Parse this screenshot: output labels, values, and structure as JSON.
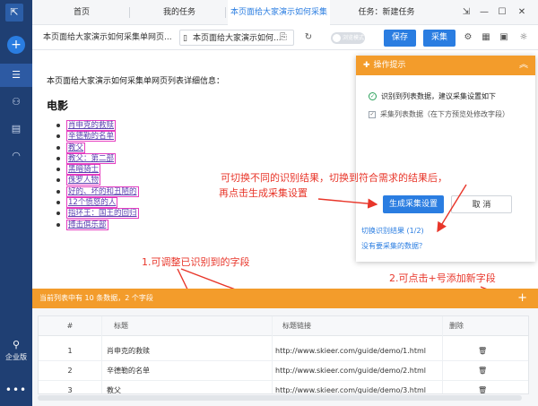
{
  "sidebar": {
    "logo": "⇱",
    "add_label": "+",
    "user_label": "企业版",
    "more_label": "•••"
  },
  "tabs": [
    {
      "label": "首页"
    },
    {
      "label": "我的任务"
    },
    {
      "label": "本页面给大家演示如何采集"
    },
    {
      "label": "任务：新建任务"
    }
  ],
  "toolbar": {
    "breadcrumb": "本页面给大家演示如何采集单网页...",
    "url": "本页面给大家演示如何...",
    "toggle_label": "浏览模式",
    "save_label": "保存",
    "collect_label": "采集"
  },
  "page": {
    "intro": "本页面给大家演示如何采集单网页列表详细信息：",
    "heading": "电影",
    "movies": [
      "肖申克的救赎",
      "辛德勒的名单",
      "教父",
      "教父：第二部",
      "黑暗骑士",
      "侏罗人物",
      "好的、坏的和丑陋的",
      "12个愤怒的人",
      "指环王：国王的回归",
      "搏击俱乐部"
    ]
  },
  "tips": {
    "title": "操作提示",
    "recognized": "识别到列表数据，建议采集设置如下",
    "option": "采集列表数据（在下方预览处修改字段）",
    "generate_label": "生成采集设置",
    "cancel_label": "取 消",
    "switch_link": "切换识别结果 (1/2)",
    "missing_link": "没有要采集的数据？"
  },
  "annotations": {
    "a1_line1": "可切换不同的识别结果，切换到符合需求的结果后，",
    "a1_line2": "再点击生成采集设置",
    "a2": "1.可调整已识别到的字段",
    "a3": "2.可点击+号添加新字段"
  },
  "data_panel": {
    "summary": "当前列表中有 10 条数据，2 个字段",
    "add_label": "+",
    "columns": [
      "#",
      "标题",
      "标题链接",
      "删除"
    ],
    "rows": [
      {
        "n": "1",
        "title": "肖申克的救赎",
        "link": "http://www.skieer.com/guide/demo/1.html"
      },
      {
        "n": "2",
        "title": "辛德勒的名单",
        "link": "http://www.skieer.com/guide/demo/2.html"
      },
      {
        "n": "3",
        "title": "教父",
        "link": "http://www.skieer.com/guide/demo/3.html"
      }
    ]
  },
  "colors": {
    "accent": "#2a7de1",
    "sidebar": "#1f3f73",
    "orange": "#f39c2b",
    "annotation": "#e8362a"
  }
}
